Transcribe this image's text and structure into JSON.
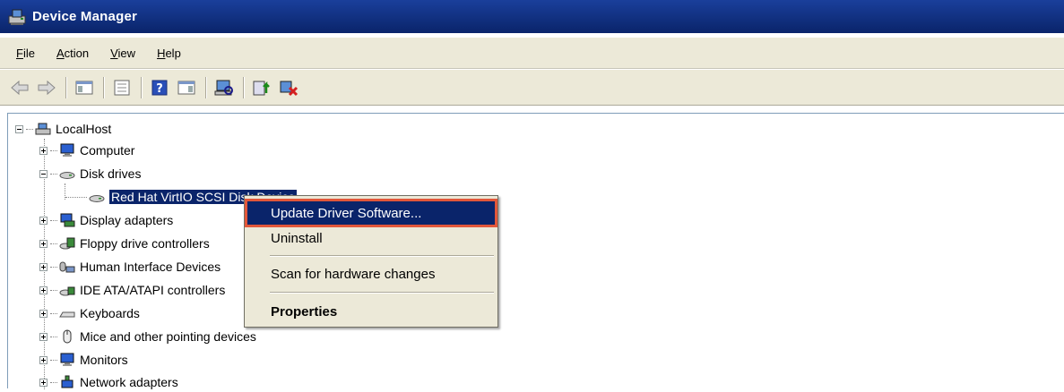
{
  "window": {
    "title": "Device Manager"
  },
  "menu": {
    "items": [
      {
        "key": "F",
        "rest": "ile"
      },
      {
        "key": "A",
        "rest": "ction"
      },
      {
        "key": "V",
        "rest": "iew"
      },
      {
        "key": "H",
        "rest": "elp"
      }
    ]
  },
  "toolbar": {
    "icons": [
      "back-arrow-icon",
      "forward-arrow-icon",
      "show-hide-console-tree-icon",
      "properties-icon",
      "help-icon",
      "show-action-pane-icon",
      "scan-hardware-icon",
      "update-driver-icon",
      "uninstall-icon"
    ]
  },
  "tree": {
    "root": "LocalHost",
    "items": [
      {
        "label": "Computer"
      },
      {
        "label": "Disk drives"
      },
      {
        "label": "Red Hat VirtIO SCSI Disk Device"
      },
      {
        "label": "Display adapters"
      },
      {
        "label": "Floppy drive controllers"
      },
      {
        "label": "Human Interface Devices"
      },
      {
        "label": "IDE ATA/ATAPI controllers"
      },
      {
        "label": "Keyboards"
      },
      {
        "label": "Mice and other pointing devices"
      },
      {
        "label": "Monitors"
      },
      {
        "label": "Network adapters"
      }
    ]
  },
  "context_menu": {
    "update": "Update Driver Software...",
    "uninstall": "Uninstall",
    "scan": "Scan for hardware changes",
    "properties": "Properties"
  },
  "colors": {
    "title_bar": "#0a246a",
    "highlight_border": "#e2573a",
    "menu_bg": "#ece9d8"
  }
}
